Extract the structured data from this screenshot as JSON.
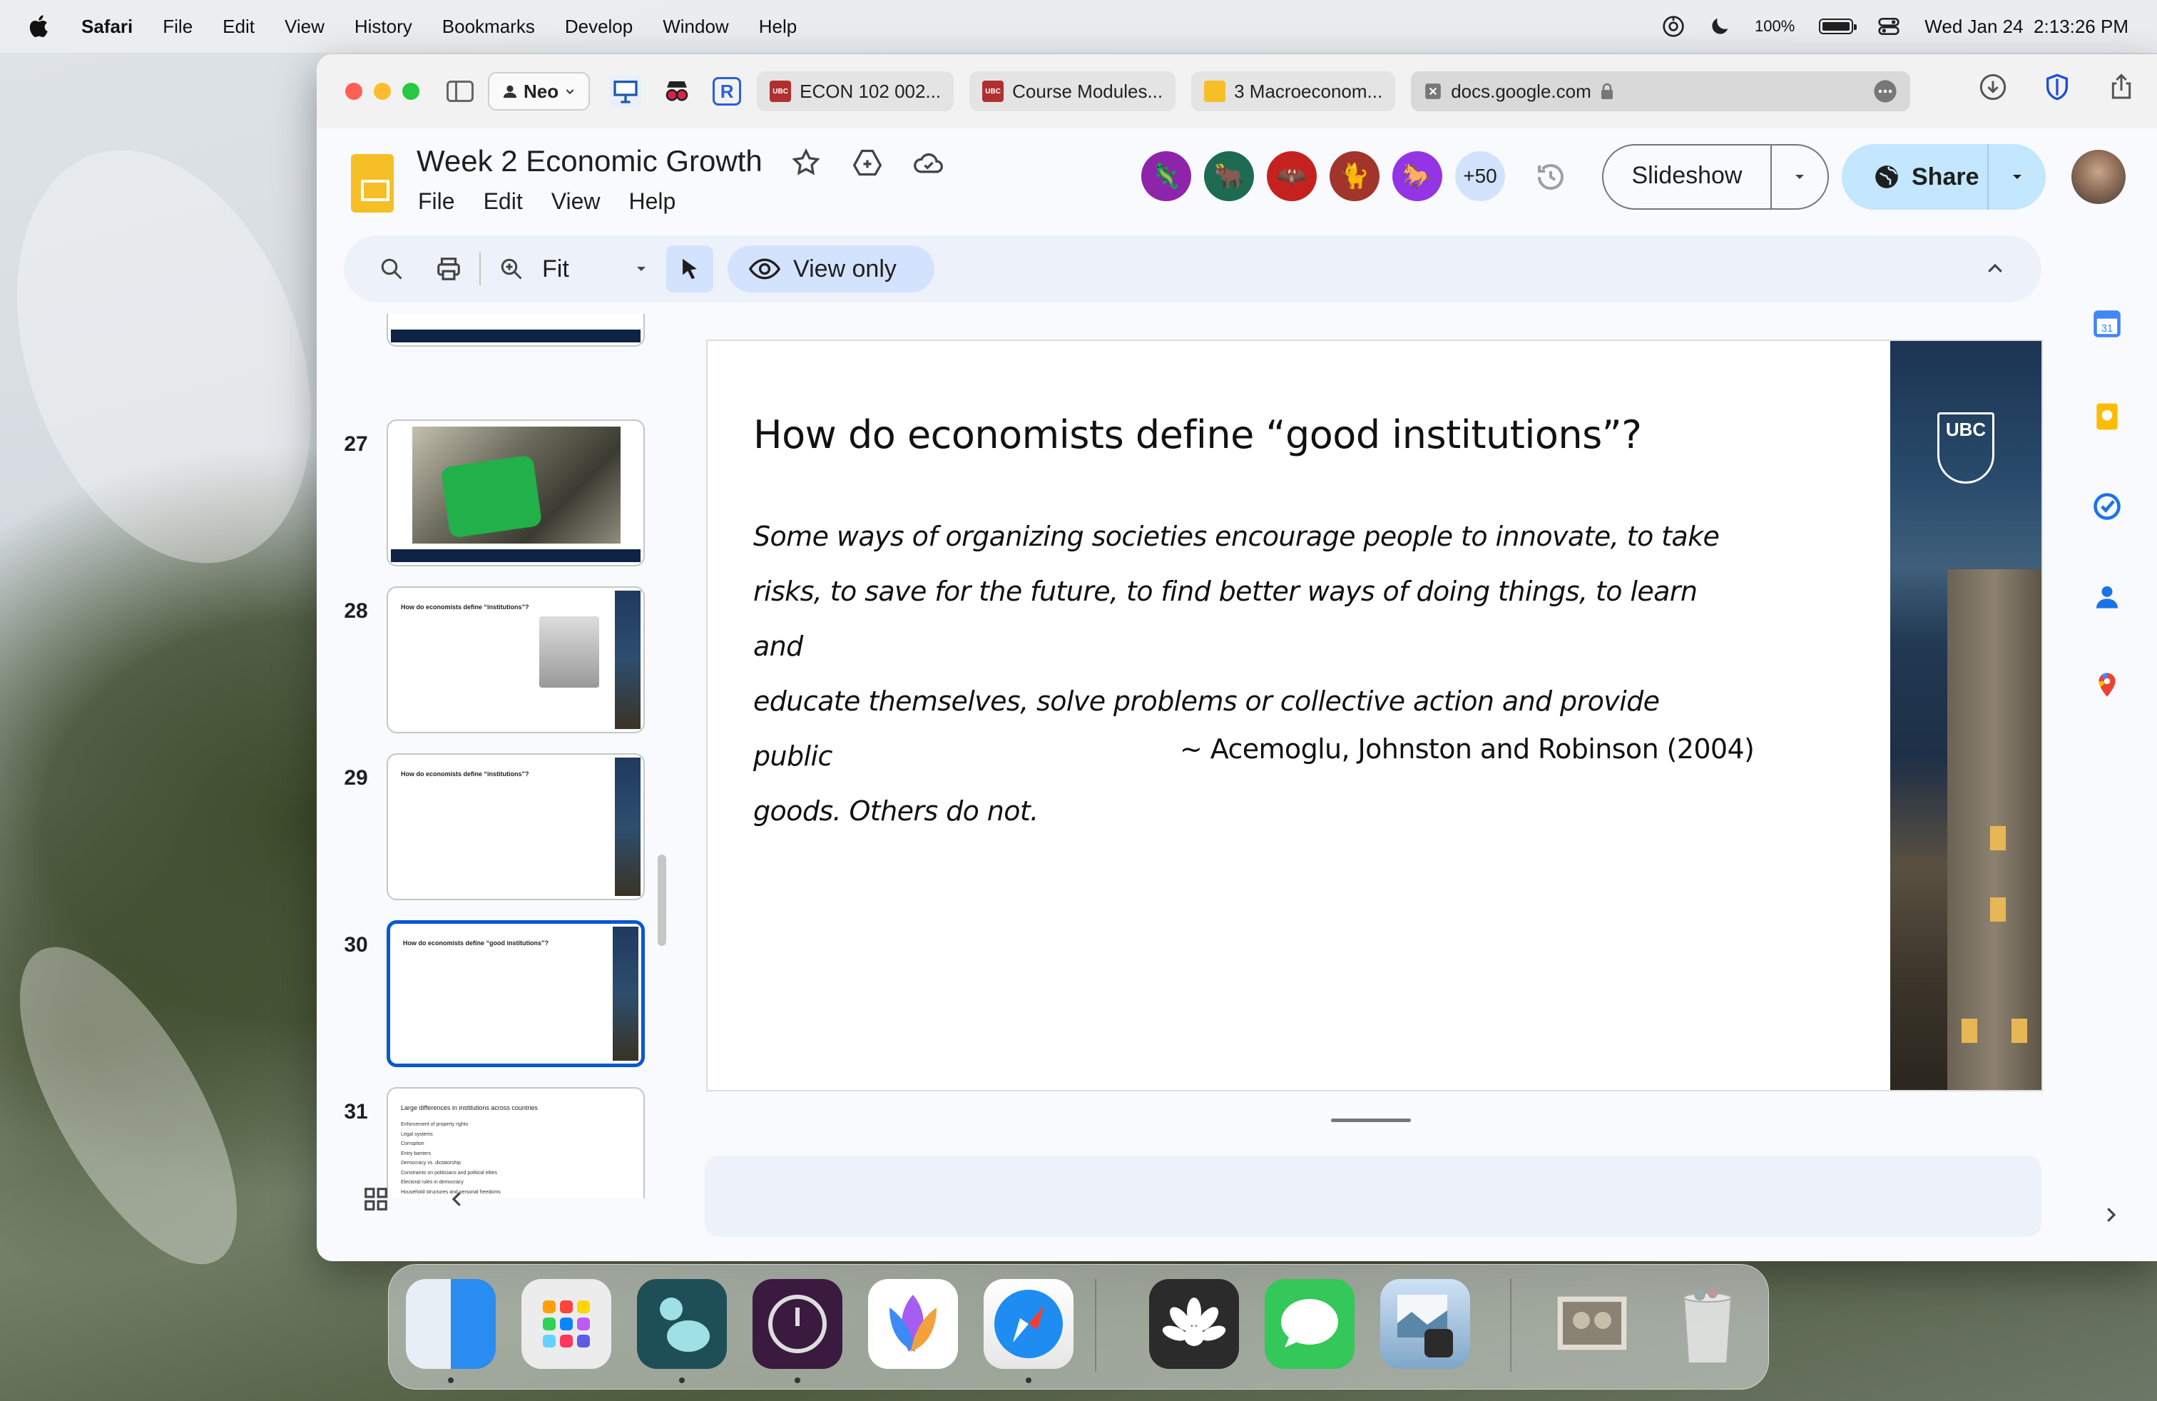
{
  "menubar": {
    "app_name": "Safari",
    "items": [
      "File",
      "Edit",
      "View",
      "History",
      "Bookmarks",
      "Develop",
      "Window",
      "Help"
    ],
    "battery": "100%",
    "datetime": "Wed Jan 24  2:13:26 PM"
  },
  "browser": {
    "profile": "Neo",
    "tabs": [
      {
        "label": "ECON 102 002...",
        "favicon": "UBC",
        "color": "#c0392b"
      },
      {
        "label": "Course Modules...",
        "favicon": "UBC",
        "color": "#c0392b"
      },
      {
        "label": "3 Macroeconom...",
        "favicon": "slides",
        "color": "#f6bf26"
      }
    ],
    "active_tab": {
      "label": "docs.google.com"
    }
  },
  "slides_app": {
    "title": "Week 2 Economic Growth",
    "menu": [
      "File",
      "Edit",
      "View",
      "Help"
    ],
    "collaborators_more": "+50",
    "slideshow_label": "Slideshow",
    "share_label": "Share",
    "toolbar": {
      "zoom_label": "Fit",
      "view_only_label": "View only"
    },
    "accent": "#0b57d0"
  },
  "filmstrip": [
    {
      "number": "27",
      "type": "photo"
    },
    {
      "number": "28",
      "title": "How do economists define “institutions”?"
    },
    {
      "number": "29",
      "title": "How do economists define “institutions”?"
    },
    {
      "number": "30",
      "title": "How do economists define “good institutions”?",
      "selected": true
    },
    {
      "number": "31",
      "title": "Large differences in institutions across countries",
      "bullets": [
        "Enforcement of property rights",
        "Legal systems",
        "Corruption",
        "Entry barriers",
        "Democracy vs. dictatorship",
        "Constraints on politicians and political elites",
        "Electoral rules in democracy",
        "Household structures and personal freedoms"
      ]
    }
  ],
  "slide": {
    "title": "How do economists define “good institutions”?",
    "body_lines": [
      "Some ways of organizing societies encourage people to innovate, to take",
      "risks, to save for the future, to find better ways of doing things, to learn and",
      "educate themselves, solve problems or collective action and provide public",
      "goods. Others do not."
    ],
    "citation": "~ Acemoglu, Johnston and Robinson (2004)",
    "logo_text": "UBC"
  }
}
